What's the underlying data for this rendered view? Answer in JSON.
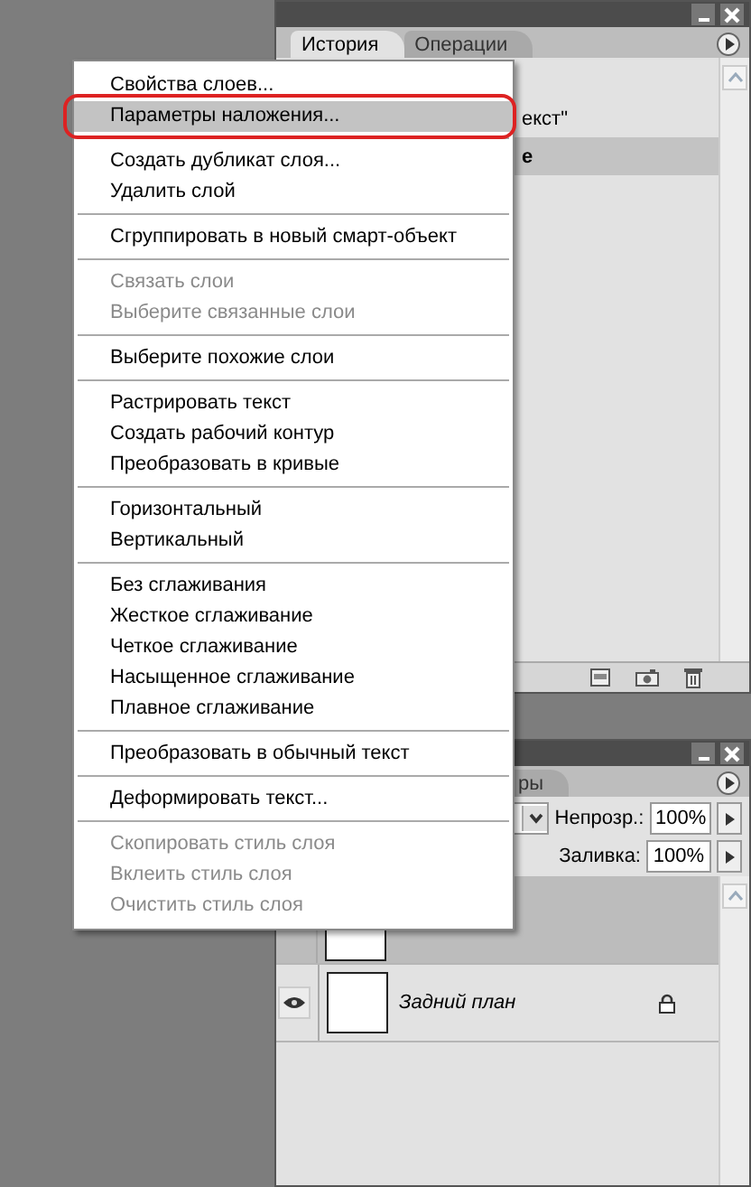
{
  "history_panel": {
    "tabs": [
      {
        "label": "История",
        "selected": true
      },
      {
        "label": "Операции",
        "selected": false
      }
    ],
    "rows": [
      {
        "text": "екст\"",
        "selected": false
      },
      {
        "text": "е",
        "selected": true
      }
    ]
  },
  "layers_panel": {
    "tabs": [
      {
        "label": "ры",
        "selected": false
      }
    ],
    "opacity": {
      "label": "Непрозр.:",
      "value": "100%"
    },
    "fill": {
      "label": "Заливка:",
      "value": "100%"
    },
    "layers": [
      {
        "selected": true
      },
      {
        "name": "Задний план",
        "selected": false,
        "visible": true,
        "locked": true
      }
    ]
  },
  "context_menu": {
    "groups": [
      [
        {
          "label": "Свойства слоев...",
          "disabled": false,
          "selected": false
        },
        {
          "label": "Параметры наложения...",
          "disabled": false,
          "selected": true
        }
      ],
      [
        {
          "label": "Создать дубликат слоя...",
          "disabled": false,
          "selected": false
        },
        {
          "label": "Удалить слой",
          "disabled": false,
          "selected": false
        }
      ],
      [
        {
          "label": "Сгруппировать в новый смарт-объект",
          "disabled": false,
          "selected": false
        }
      ],
      [
        {
          "label": "Связать слои",
          "disabled": true,
          "selected": false
        },
        {
          "label": "Выберите связанные слои",
          "disabled": true,
          "selected": false
        }
      ],
      [
        {
          "label": "Выберите похожие слои",
          "disabled": false,
          "selected": false
        }
      ],
      [
        {
          "label": "Растрировать текст",
          "disabled": false,
          "selected": false
        },
        {
          "label": "Создать рабочий контур",
          "disabled": false,
          "selected": false
        },
        {
          "label": "Преобразовать в кривые",
          "disabled": false,
          "selected": false
        }
      ],
      [
        {
          "label": "Горизонтальный",
          "disabled": false,
          "selected": false
        },
        {
          "label": "Вертикальный",
          "disabled": false,
          "selected": false
        }
      ],
      [
        {
          "label": "Без сглаживания",
          "disabled": false,
          "selected": false
        },
        {
          "label": "Жесткое сглаживание",
          "disabled": false,
          "selected": false
        },
        {
          "label": "Четкое сглаживание",
          "disabled": false,
          "selected": false
        },
        {
          "label": "Насыщенное сглаживание",
          "disabled": false,
          "selected": false
        },
        {
          "label": "Плавное сглаживание",
          "disabled": false,
          "selected": false
        }
      ],
      [
        {
          "label": "Преобразовать в обычный текст",
          "disabled": false,
          "selected": false
        }
      ],
      [
        {
          "label": "Деформировать текст...",
          "disabled": false,
          "selected": false
        }
      ],
      [
        {
          "label": "Скопировать стиль слоя",
          "disabled": true,
          "selected": false
        },
        {
          "label": "Вклеить стиль слоя",
          "disabled": true,
          "selected": false
        },
        {
          "label": "Очистить стиль слоя",
          "disabled": true,
          "selected": false
        }
      ]
    ]
  }
}
